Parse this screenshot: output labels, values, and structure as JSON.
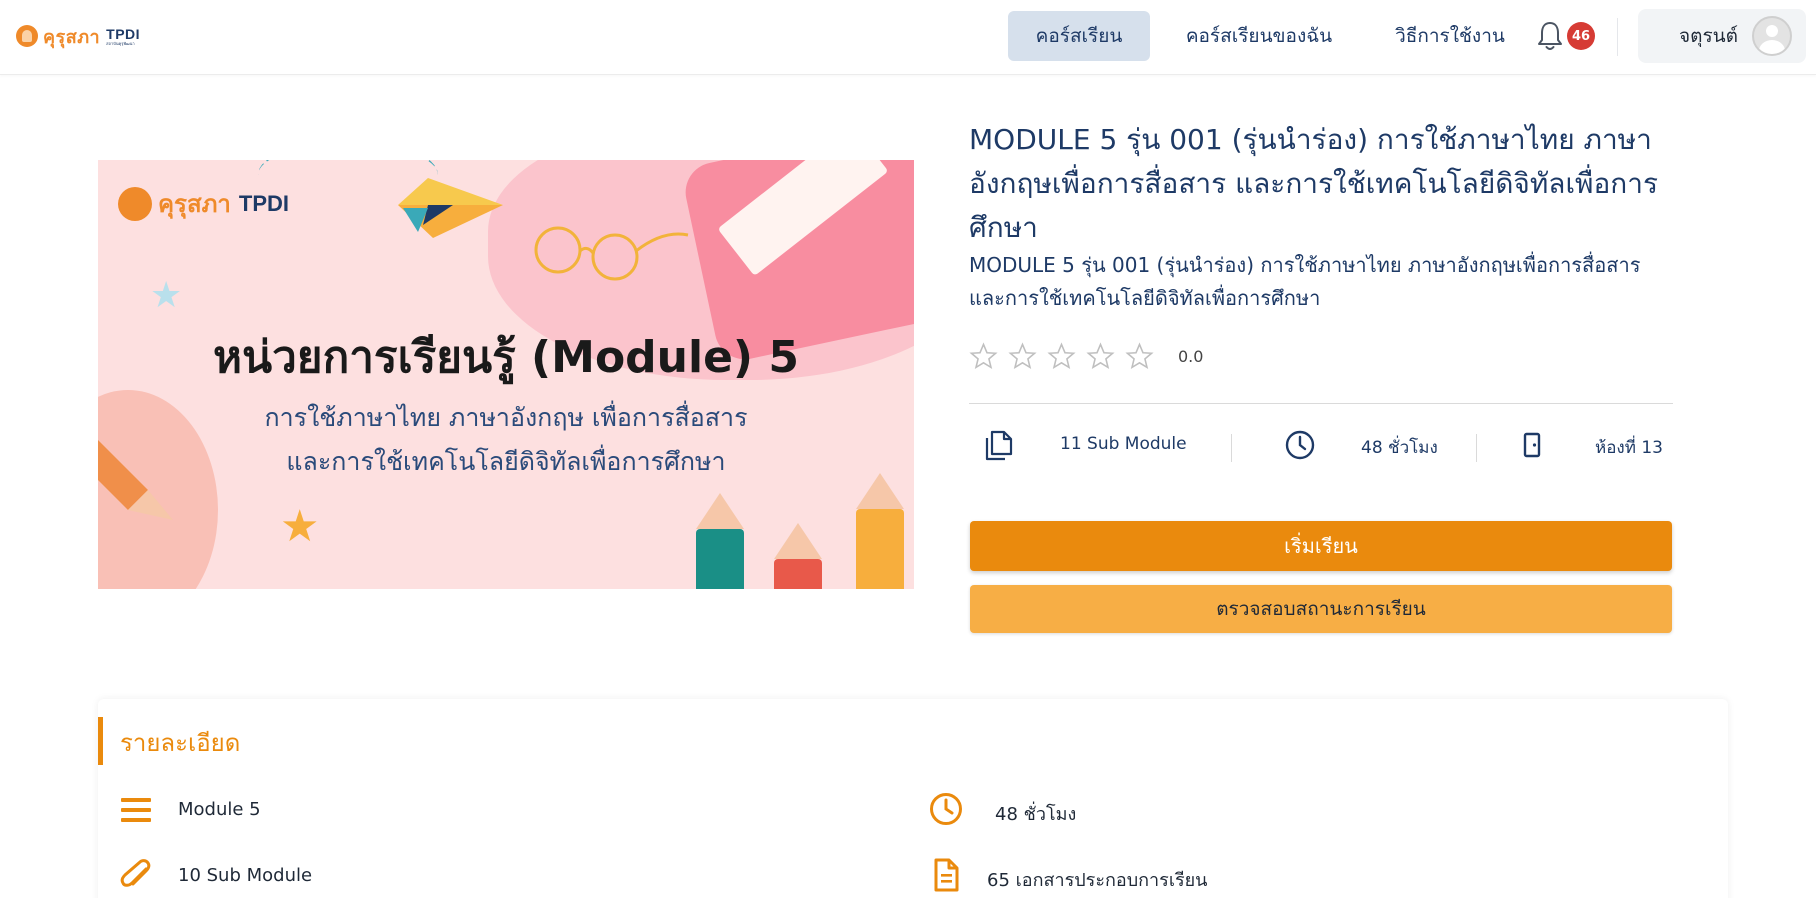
{
  "header": {
    "logo_text": "คุรุสภา",
    "logo_tpdi": "TPDI",
    "logo_sub": "สถาบันคุรุพัฒนา",
    "nav": [
      {
        "label": "คอร์สเรียน",
        "active": true
      },
      {
        "label": "คอร์สเรียนของฉัน",
        "active": false
      },
      {
        "label": "วิธีการใช้งาน",
        "active": false
      }
    ],
    "notification_count": "46",
    "user_name": "จตุรนต์"
  },
  "banner": {
    "logo_text": "คุรุสภา",
    "logo_tpdi": "TPDI",
    "title": "หน่วยการเรียนรู้ (Module) 5",
    "subtitle_line1": "การใช้ภาษาไทย ภาษาอังกฤษ เพื่อการสื่อสาร",
    "subtitle_line2": "และการใช้เทคโนโลยีดิจิทัลเพื่อการศึกษา"
  },
  "course": {
    "title": "MODULE 5 รุ่น 001 (รุ่นนำร่อง) การใช้ภาษาไทย ภาษาอังกฤษเพื่อการสื่อสาร และการใช้เทคโนโลยีดิจิทัลเพื่อการศึกษา",
    "subtitle": "MODULE 5 รุ่น 001 (รุ่นนำร่อง) การใช้ภาษาไทย ภาษาอังกฤษเพื่อการสื่อสาร และการใช้เทคโนโลยีดิจิทัลเพื่อการศึกษา",
    "rating_stars": 0,
    "rating_max": 5,
    "rating_value": "0.0",
    "stats": {
      "sub_modules": "11 Sub Module",
      "hours": "48 ชั่วโมง",
      "room": "ห้องที่ 13"
    },
    "start_button": "เริ่มเรียน",
    "status_button": "ตรวจสอบสถานะการเรียน"
  },
  "details": {
    "title": "รายละเอียด",
    "items": {
      "module": "Module 5",
      "hours": "48 ชั่วโมง",
      "sub_modules": "10 Sub Module",
      "documents": "65 เอกสารประกอบการเรียน"
    }
  },
  "colors": {
    "primary_orange": "#ea8a0d",
    "light_orange": "#f7ae45",
    "navy": "#1e3a66",
    "badge_red": "#d63b34",
    "nav_active_bg": "#d6e0ec"
  }
}
